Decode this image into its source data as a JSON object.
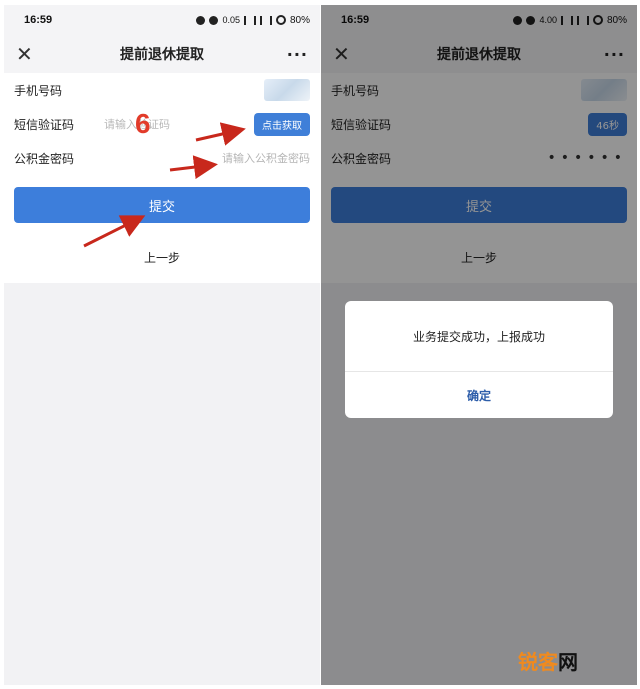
{
  "status": {
    "time": "16:59",
    "battery": "80%",
    "net_left": "0.05",
    "net_right": "4.00"
  },
  "header": {
    "title": "提前退休提取",
    "more": "···",
    "close": "✕"
  },
  "form": {
    "phone_label": "手机号码",
    "sms_label": "短信验证码",
    "sms_placeholder": "请输入验证码",
    "get_code_label": "点击获取",
    "countdown_label": "46秒",
    "pwd_label": "公积金密码",
    "pwd_placeholder": "请输入公积金密码",
    "pwd_masked": "••••••"
  },
  "actions": {
    "submit_label": "提交",
    "prev_label": "上一步"
  },
  "dialog": {
    "message": "业务提交成功，上报成功",
    "confirm_label": "确定"
  },
  "annotation": {
    "step_number": "6"
  },
  "watermark": {
    "part1": "锐客",
    "part2": "网"
  },
  "colors": {
    "accent": "#3d7edb",
    "annotation": "#e23b2a",
    "watermark": "#f08a1e"
  }
}
